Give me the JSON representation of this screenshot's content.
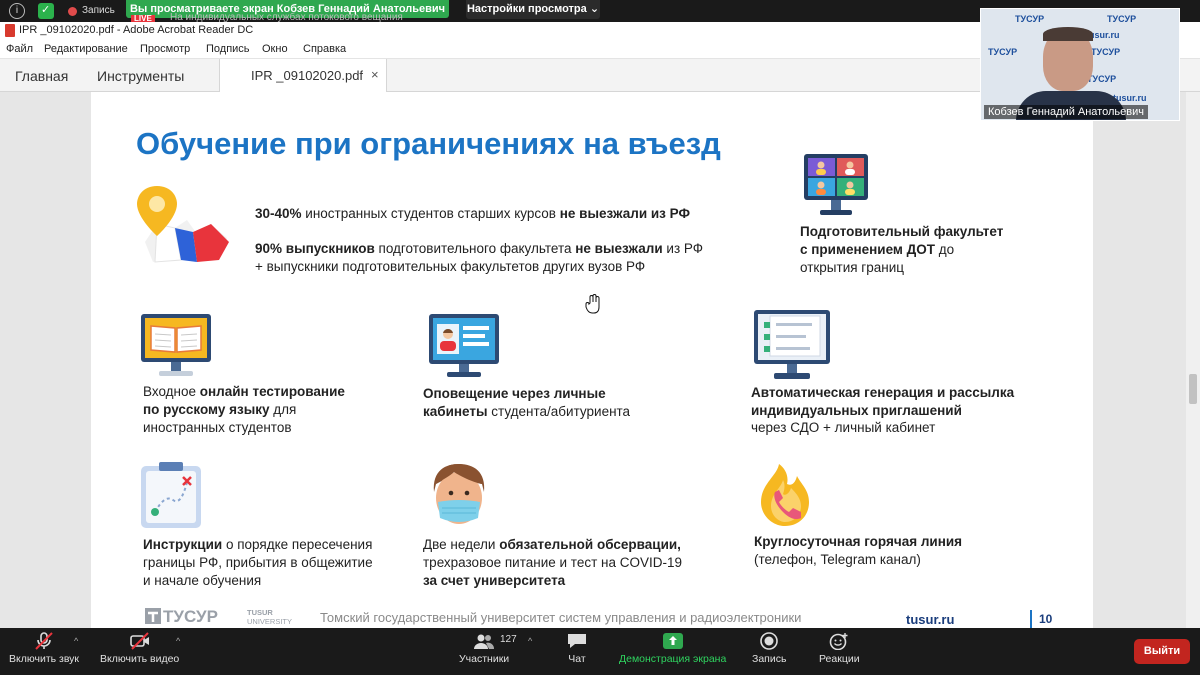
{
  "zoom_top": {
    "record_label": "Запись",
    "share_banner": "Вы просматриваете экран Кобзев Геннадий Анатольевич",
    "view_options": "Настройки просмотра",
    "live_badge": "LIVE",
    "live_text": "На индивидуальных службах потокового вещания"
  },
  "acrobat": {
    "title": "IPR _09102020.pdf - Adobe Acrobat Reader DC",
    "menu": [
      "Файл",
      "Редактирование",
      "Просмотр",
      "Подпись",
      "Окно",
      "Справка"
    ],
    "nav_tabs": [
      "Главная",
      "Инструменты"
    ],
    "doc_tab": "IPR _09102020.pdf",
    "close_glyph": "×"
  },
  "slide": {
    "title": "Обучение при ограничениях на въезд",
    "intro": {
      "line1": {
        "a": "30-40%",
        "b": " иностранных студентов старших курсов ",
        "c": "не выезжали из РФ"
      },
      "line2": {
        "a": "90% выпускников",
        "b": " подготовительного факультета ",
        "c": "не выезжали",
        "d": " из РФ"
      },
      "line3": "+ выпускники подготовительных факультетов других вузов РФ"
    },
    "prep_faculty": {
      "line1": "Подготовительный факультет",
      "line2_bold": "с применением ДОТ",
      "line2_rest": " до",
      "line3": "открытия границ"
    },
    "testing": {
      "l1a": "Входное ",
      "l1b": "онлайн тестирование",
      "l2a": "по русскому языку",
      "l2b": " для",
      "l3": "иностранных студентов"
    },
    "notify": {
      "l1": "Оповещение через личные",
      "l2a": "кабинеты",
      "l2b": " студента/абитуриента"
    },
    "autogen": {
      "l1": "Автоматическая генерация и рассылка",
      "l2": "индивидуальных приглашений",
      "l3": "через СДО + личный кабинет"
    },
    "instructions": {
      "l1a": "Инструкции",
      "l1b": " о порядке пересечения",
      "l2": "границы РФ, прибытия в общежитие",
      "l3": "и начале обучения"
    },
    "quarantine": {
      "l1a": "Две недели ",
      "l1b": "обязательной обсервации,",
      "l2": "трехразовое питание и тест на COVID-19",
      "l3": "за счет университета"
    },
    "hotline": {
      "l1": "Круглосуточная горячая линия",
      "l2": "(телефон, Telegram канал)"
    },
    "footer": {
      "logo_main": "ТУСУР",
      "logo_sub1": "TUSUR",
      "logo_sub2": "UNIVERSITY",
      "university": "Томский государственный университет систем управления и радиоэлектроники",
      "url": "tusur.ru",
      "page_number": "10"
    }
  },
  "video": {
    "speaker_name": "Кобзев Геннадий Анатольевич",
    "backdrop_logo": "ТУСУР",
    "backdrop_url": "tusur.ru"
  },
  "zoom_bottom": {
    "unmute": "Включить звук",
    "start_video": "Включить видео",
    "participants": "Участники",
    "participants_count": "127",
    "chat": "Чат",
    "share_screen": "Демонстрация экрана",
    "record": "Запись",
    "reactions": "Реакции",
    "leave": "Выйти"
  },
  "colors": {
    "title_blue": "#1c74c4",
    "zoom_green": "#2fa84f",
    "leave_red": "#c2251f"
  }
}
